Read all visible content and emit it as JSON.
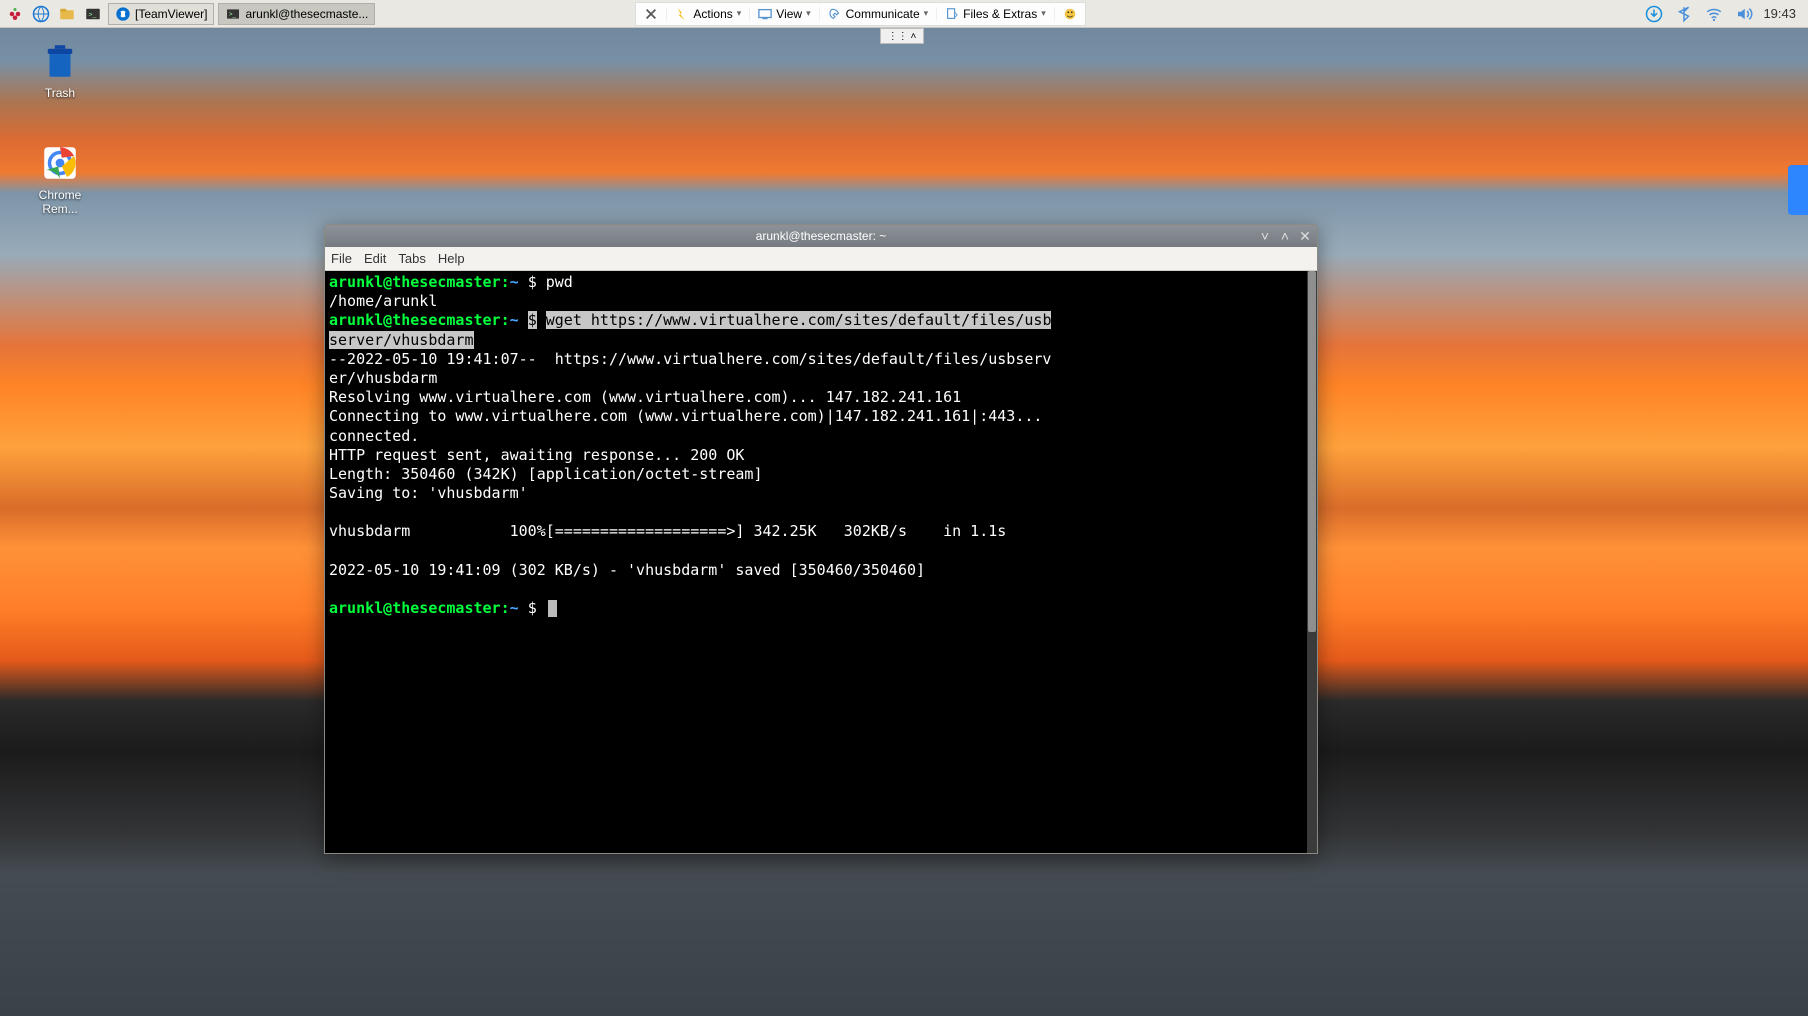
{
  "taskbar": {
    "items": [
      {
        "label": "[TeamViewer]"
      },
      {
        "label": "arunkl@thesecmaste..."
      }
    ],
    "menu": {
      "actions": "Actions",
      "view": "View",
      "comm": "Communicate",
      "files": "Files & Extras"
    },
    "clock": "19:43"
  },
  "desktop": {
    "trash": "Trash",
    "chrome": "Chrome Rem..."
  },
  "terminal": {
    "title": "arunkl@thesecmaster: ~",
    "menus": {
      "file": "File",
      "edit": "Edit",
      "tabs": "Tabs",
      "help": "Help"
    },
    "prompt_user1": "arunkl@thesecmaster",
    "prompt_path1": "~",
    "dollar": "$",
    "cmd1": "pwd",
    "out_pwd": "/home/arunkl",
    "cmd2_part1": "wget https://www.virtualhere.com/sites/default/files/usb",
    "cmd2_part2": "server/vhusbdarm",
    "wget_lines": "--2022-05-10 19:41:07--  https://www.virtualhere.com/sites/default/files/usbserv\ner/vhusbdarm\nResolving www.virtualhere.com (www.virtualhere.com)... 147.182.241.161\nConnecting to www.virtualhere.com (www.virtualhere.com)|147.182.241.161|:443...\nconnected.\nHTTP request sent, awaiting response... 200 OK\nLength: 350460 (342K) [application/octet-stream]\nSaving to: 'vhusbdarm'\n\nvhusbdarm           100%[===================>] 342.25K   302KB/s    in 1.1s\n\n2022-05-10 19:41:09 (302 KB/s) - 'vhusbdarm' saved [350460/350460]\n"
  }
}
